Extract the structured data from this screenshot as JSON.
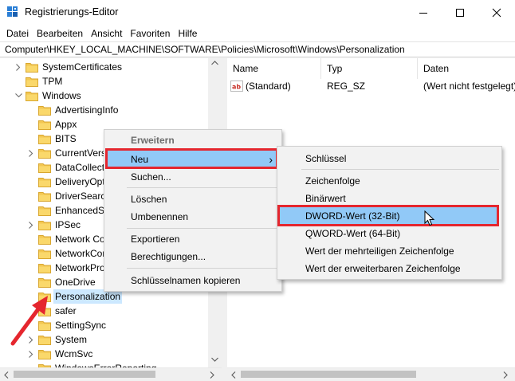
{
  "window": {
    "title": "Registrierungs-Editor"
  },
  "menu": [
    "Datei",
    "Bearbeiten",
    "Ansicht",
    "Favoriten",
    "Hilfe"
  ],
  "address": "Computer\\HKEY_LOCAL_MACHINE\\SOFTWARE\\Policies\\Microsoft\\Windows\\Personalization",
  "tree": {
    "items": [
      {
        "label": "SystemCertificates"
      },
      {
        "label": "TPM"
      },
      {
        "label": "Windows"
      },
      {
        "label": "AdvertisingInfo"
      },
      {
        "label": "Appx"
      },
      {
        "label": "BITS"
      },
      {
        "label": "CurrentVers"
      },
      {
        "label": "DataCollect"
      },
      {
        "label": "DeliveryOpt"
      },
      {
        "label": "DriverSearch"
      },
      {
        "label": "EnhancedSt"
      },
      {
        "label": "IPSec"
      },
      {
        "label": "Network Co"
      },
      {
        "label": "NetworkCor"
      },
      {
        "label": "NetworkPro"
      },
      {
        "label": "OneDrive"
      },
      {
        "label": "Personalization"
      },
      {
        "label": "safer"
      },
      {
        "label": "SettingSync"
      },
      {
        "label": "System"
      },
      {
        "label": "WcmSvc"
      },
      {
        "label": "WindowsErrorReporting"
      }
    ]
  },
  "list": {
    "columns": [
      "Name",
      "Typ",
      "Daten"
    ],
    "rows": [
      {
        "name": "(Standard)",
        "type": "REG_SZ",
        "data": "(Wert nicht festgelegt)"
      }
    ]
  },
  "context_menu": {
    "header": "Erweitern",
    "items": [
      "Neu",
      "Suchen...",
      "Löschen",
      "Umbenennen",
      "Exportieren",
      "Berechtigungen...",
      "Schlüsselnamen kopieren"
    ],
    "arrow": "›"
  },
  "submenu": {
    "items": [
      "Schlüssel",
      "Zeichenfolge",
      "Binärwert",
      "DWORD-Wert (32-Bit)",
      "QWORD-Wert (64-Bit)",
      "Wert der mehrteiligen Zeichenfolge",
      "Wert der erweiterbaren Zeichenfolge"
    ]
  },
  "colors": {
    "highlight": "#91c9f7",
    "selection": "#cce8ff",
    "annotation_red": "#e5262e",
    "folder": "#f3c752"
  }
}
